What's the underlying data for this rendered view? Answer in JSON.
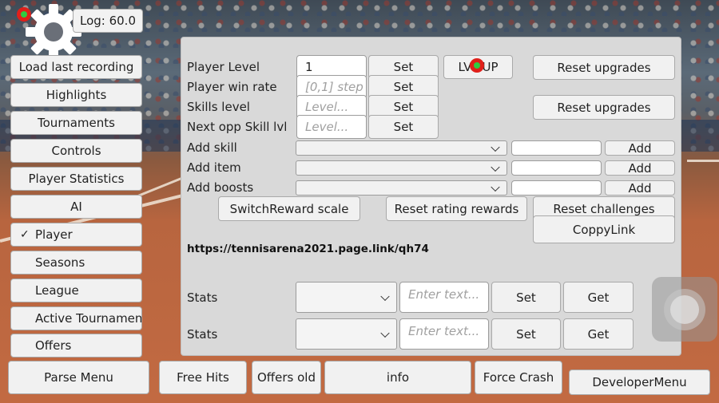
{
  "log_badge": "Log: 60.0",
  "left_menu": [
    {
      "label": "Load last recording",
      "checked": false
    },
    {
      "label": "Highlights",
      "checked": false
    },
    {
      "label": "Tournaments",
      "checked": false
    },
    {
      "label": "Controls",
      "checked": false
    },
    {
      "label": "Player Statistics",
      "checked": false
    },
    {
      "label": "AI",
      "checked": false
    },
    {
      "label": "Player",
      "checked": true
    },
    {
      "label": "Seasons",
      "checked": false
    },
    {
      "label": "League",
      "checked": false
    },
    {
      "label": "Active Tournament",
      "checked": false
    },
    {
      "label": "Offers",
      "checked": false
    }
  ],
  "checkmark": "✓",
  "panel": {
    "rows": [
      {
        "label": "Player Level",
        "value": "1",
        "placeholder": "",
        "button": "Set"
      },
      {
        "label": "Player win rate",
        "value": "",
        "placeholder": "[0,1] step",
        "button": "Set"
      },
      {
        "label": "Skills level",
        "value": "",
        "placeholder": "Level...",
        "button": "Set"
      },
      {
        "label": "Next opp Skill lvl",
        "value": "",
        "placeholder": "Level...",
        "button": "Set"
      }
    ],
    "lvl_up": "LVL UP",
    "reset_upgrades_1": "Reset upgrades",
    "reset_upgrades_2": "Reset upgrades",
    "add_rows": [
      {
        "label": "Add skill",
        "button": "Add"
      },
      {
        "label": "Add item",
        "button": "Add"
      },
      {
        "label": "Add boosts",
        "button": "Add"
      }
    ],
    "switch_reward_scale": "SwitchReward scale",
    "reset_rating_rewards": "Reset rating rewards",
    "reset_challenges": "Reset challenges",
    "copy_link": "CoppyLink",
    "link_text": "https://tennisarena2021.page.link/qh74",
    "stats_rows": [
      {
        "label": "Stats",
        "placeholder": "Enter text...",
        "set": "Set",
        "get": "Get"
      },
      {
        "label": "Stats",
        "placeholder": "Enter text...",
        "set": "Set",
        "get": "Get"
      }
    ]
  },
  "bottom_bar": {
    "parse_menu": "Parse Menu",
    "free_hits": "Free Hits",
    "offers_old": "Offers old",
    "info": "info",
    "force_crash": "Force Crash",
    "developer_menu": "DeveloperMenu"
  },
  "icons": {
    "settings": "gear-icon",
    "joystick": "joystick-icon",
    "touch_marker": "touch-marker-icon"
  },
  "colors": {
    "panel_bg": "#d9d9d9",
    "button_bg": "#f1f1f1",
    "marker_ring": "#e0201a",
    "marker_dot": "#2ecc40"
  }
}
